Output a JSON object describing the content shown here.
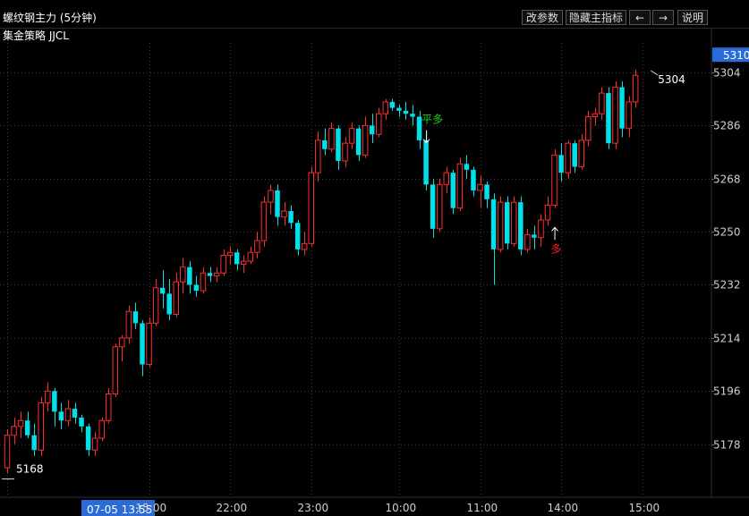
{
  "header": {
    "title": "螺纹钢主力 (5分钟)",
    "strategy": "集金策略 JJCL",
    "buttons": [
      "改参数",
      "隐藏主指标",
      "←",
      "→",
      "说明"
    ]
  },
  "colors": {
    "up": "#ff2d2d",
    "down": "#00e0e8",
    "signal_green": "#22cc22",
    "signal_red": "#ff2020",
    "price_tag_bg": "#2a6bd8",
    "xlabel_bg": "#2a6bd8"
  },
  "chart_data": {
    "type": "candlestick",
    "ylim": [
      5160,
      5314
    ],
    "yticks": [
      5178,
      5196,
      5214,
      5232,
      5250,
      5268,
      5286,
      5304
    ],
    "current_price": "5310",
    "xticks": [
      {
        "label": "07-05 13:55",
        "index": 0,
        "highlight": true
      },
      {
        "label": "15:00",
        "index": 21
      },
      {
        "label": "22:00",
        "index": 33
      },
      {
        "label": "23:00",
        "index": 45
      },
      {
        "label": "10:00",
        "index": 58
      },
      {
        "label": "11:00",
        "index": 70
      },
      {
        "label": "14:00",
        "index": 82
      },
      {
        "label": "15:00",
        "index": 94
      }
    ],
    "candles": [
      [
        5170,
        5183,
        5168,
        5181
      ],
      [
        5181,
        5187,
        5178,
        5184
      ],
      [
        5184,
        5189,
        5180,
        5186
      ],
      [
        5186,
        5189,
        5180,
        5181
      ],
      [
        5181,
        5185,
        5174,
        5176
      ],
      [
        5176,
        5194,
        5174,
        5192
      ],
      [
        5192,
        5199,
        5189,
        5196
      ],
      [
        5196,
        5197,
        5184,
        5189
      ],
      [
        5189,
        5192,
        5183,
        5186
      ],
      [
        5186,
        5193,
        5184,
        5190
      ],
      [
        5190,
        5192,
        5185,
        5187
      ],
      [
        5187,
        5188,
        5182,
        5184
      ],
      [
        5184,
        5185,
        5174,
        5176
      ],
      [
        5176,
        5182,
        5174,
        5180
      ],
      [
        5180,
        5187,
        5179,
        5186
      ],
      [
        5186,
        5197,
        5185,
        5195
      ],
      [
        5195,
        5212,
        5194,
        5211
      ],
      [
        5211,
        5215,
        5206,
        5214
      ],
      [
        5214,
        5225,
        5212,
        5223
      ],
      [
        5223,
        5226,
        5217,
        5219
      ],
      [
        5219,
        5220,
        5201,
        5205
      ],
      [
        5205,
        5221,
        5204,
        5219
      ],
      [
        5219,
        5234,
        5218,
        5231
      ],
      [
        5231,
        5237,
        5224,
        5229
      ],
      [
        5229,
        5234,
        5220,
        5222
      ],
      [
        5222,
        5236,
        5221,
        5233
      ],
      [
        5233,
        5241,
        5229,
        5238
      ],
      [
        5238,
        5240,
        5229,
        5232
      ],
      [
        5232,
        5235,
        5228,
        5230
      ],
      [
        5230,
        5238,
        5229,
        5236
      ],
      [
        5236,
        5238,
        5233,
        5235
      ],
      [
        5235,
        5238,
        5233,
        5236
      ],
      [
        5236,
        5244,
        5235,
        5242
      ],
      [
        5242,
        5245,
        5239,
        5243
      ],
      [
        5243,
        5244,
        5237,
        5239
      ],
      [
        5239,
        5242,
        5236,
        5240
      ],
      [
        5240,
        5245,
        5239,
        5243
      ],
      [
        5243,
        5250,
        5241,
        5247
      ],
      [
        5247,
        5262,
        5245,
        5260
      ],
      [
        5260,
        5266,
        5256,
        5264
      ],
      [
        5264,
        5266,
        5252,
        5255
      ],
      [
        5255,
        5260,
        5252,
        5257
      ],
      [
        5257,
        5259,
        5251,
        5253
      ],
      [
        5253,
        5254,
        5242,
        5244
      ],
      [
        5244,
        5250,
        5242,
        5246
      ],
      [
        5246,
        5272,
        5245,
        5270
      ],
      [
        5270,
        5284,
        5267,
        5281
      ],
      [
        5281,
        5285,
        5276,
        5278
      ],
      [
        5278,
        5287,
        5277,
        5285
      ],
      [
        5285,
        5286,
        5271,
        5274
      ],
      [
        5274,
        5282,
        5272,
        5280
      ],
      [
        5280,
        5287,
        5278,
        5285
      ],
      [
        5285,
        5286,
        5274,
        5276
      ],
      [
        5276,
        5289,
        5275,
        5286
      ],
      [
        5286,
        5290,
        5280,
        5283
      ],
      [
        5283,
        5292,
        5282,
        5290
      ],
      [
        5290,
        5295,
        5288,
        5294
      ],
      [
        5294,
        5295,
        5291,
        5292
      ],
      [
        5292,
        5293,
        5289,
        5291
      ],
      [
        5291,
        5294,
        5288,
        5290
      ],
      [
        5290,
        5293,
        5286,
        5289
      ],
      [
        5289,
        5291,
        5278,
        5281
      ],
      [
        5281,
        5283,
        5264,
        5266
      ],
      [
        5266,
        5268,
        5248,
        5251
      ],
      [
        5251,
        5268,
        5250,
        5266
      ],
      [
        5266,
        5272,
        5263,
        5270
      ],
      [
        5270,
        5271,
        5256,
        5258
      ],
      [
        5258,
        5275,
        5257,
        5273
      ],
      [
        5273,
        5276,
        5268,
        5271
      ],
      [
        5271,
        5272,
        5262,
        5264
      ],
      [
        5264,
        5269,
        5258,
        5266
      ],
      [
        5266,
        5267,
        5258,
        5261
      ],
      [
        5261,
        5263,
        5232,
        5244
      ],
      [
        5244,
        5262,
        5243,
        5260
      ],
      [
        5260,
        5262,
        5244,
        5246
      ],
      [
        5246,
        5262,
        5245,
        5260
      ],
      [
        5260,
        5262,
        5242,
        5244
      ],
      [
        5244,
        5251,
        5243,
        5249
      ],
      [
        5249,
        5252,
        5244,
        5248
      ],
      [
        5248,
        5256,
        5245,
        5254
      ],
      [
        5254,
        5262,
        5252,
        5259
      ],
      [
        5259,
        5278,
        5258,
        5276
      ],
      [
        5276,
        5280,
        5267,
        5270
      ],
      [
        5270,
        5281,
        5268,
        5280
      ],
      [
        5280,
        5281,
        5270,
        5272
      ],
      [
        5272,
        5283,
        5271,
        5281
      ],
      [
        5281,
        5291,
        5279,
        5289
      ],
      [
        5289,
        5292,
        5286,
        5290
      ],
      [
        5290,
        5299,
        5288,
        5297
      ],
      [
        5297,
        5299,
        5278,
        5280
      ],
      [
        5280,
        5301,
        5278,
        5299
      ],
      [
        5299,
        5301,
        5282,
        5285
      ],
      [
        5285,
        5296,
        5282,
        5294
      ],
      [
        5294,
        5305,
        5292,
        5303
      ]
    ],
    "annotations": [
      {
        "text": "5168",
        "index": 0,
        "price": 5168
      },
      {
        "text": "5304",
        "index": 95,
        "price": 5304
      },
      {
        "text": "平多",
        "index": 62,
        "price": 5285,
        "color": "green"
      },
      {
        "text": "多",
        "index": 81,
        "price": 5246,
        "color": "red"
      }
    ]
  }
}
